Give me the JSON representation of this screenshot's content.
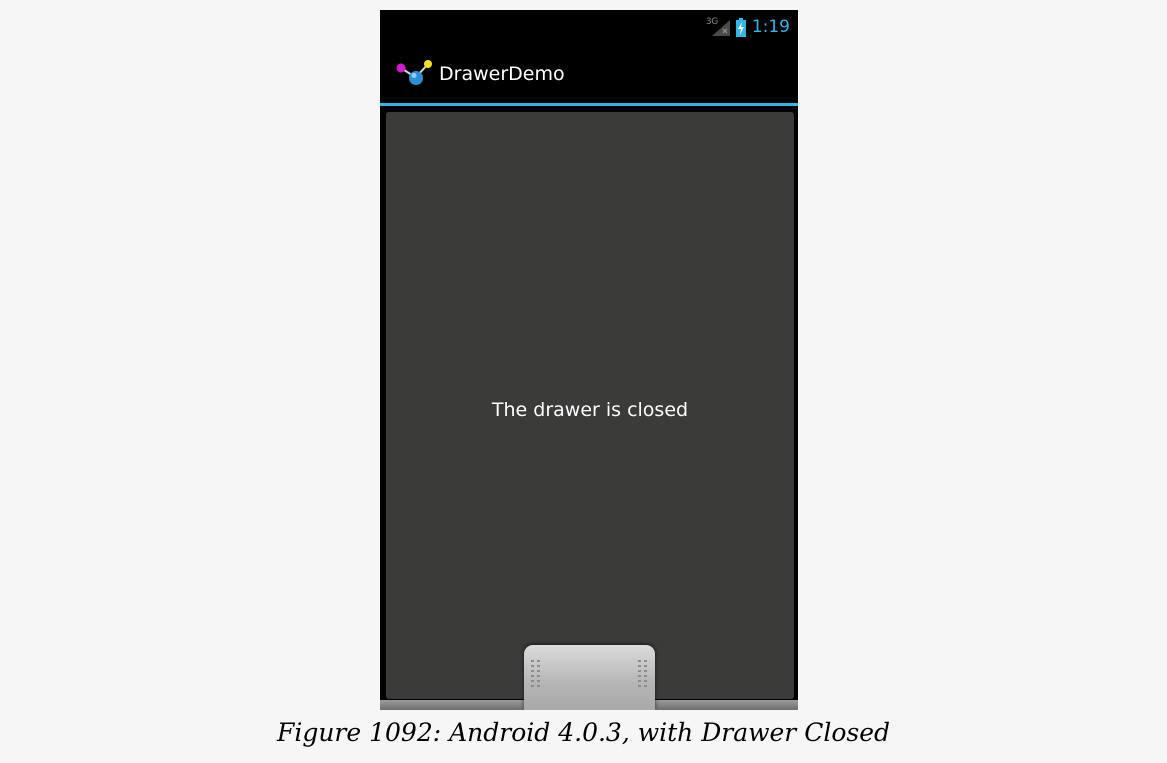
{
  "status_bar": {
    "network_type": "3G",
    "clock": "1:19"
  },
  "action_bar": {
    "title": "DrawerDemo",
    "app_icon": "molecule-app-icon"
  },
  "content": {
    "status_text": "The drawer is closed"
  },
  "drawer": {
    "state": "closed",
    "handle_icon": "drawer-grip-icon"
  },
  "caption": "Figure 1092: Android 4.0.3, with Drawer Closed",
  "colors": {
    "accent": "#33b5e5",
    "content_bg": "#3b3c3a",
    "page_bg": "#f6f6f6"
  }
}
